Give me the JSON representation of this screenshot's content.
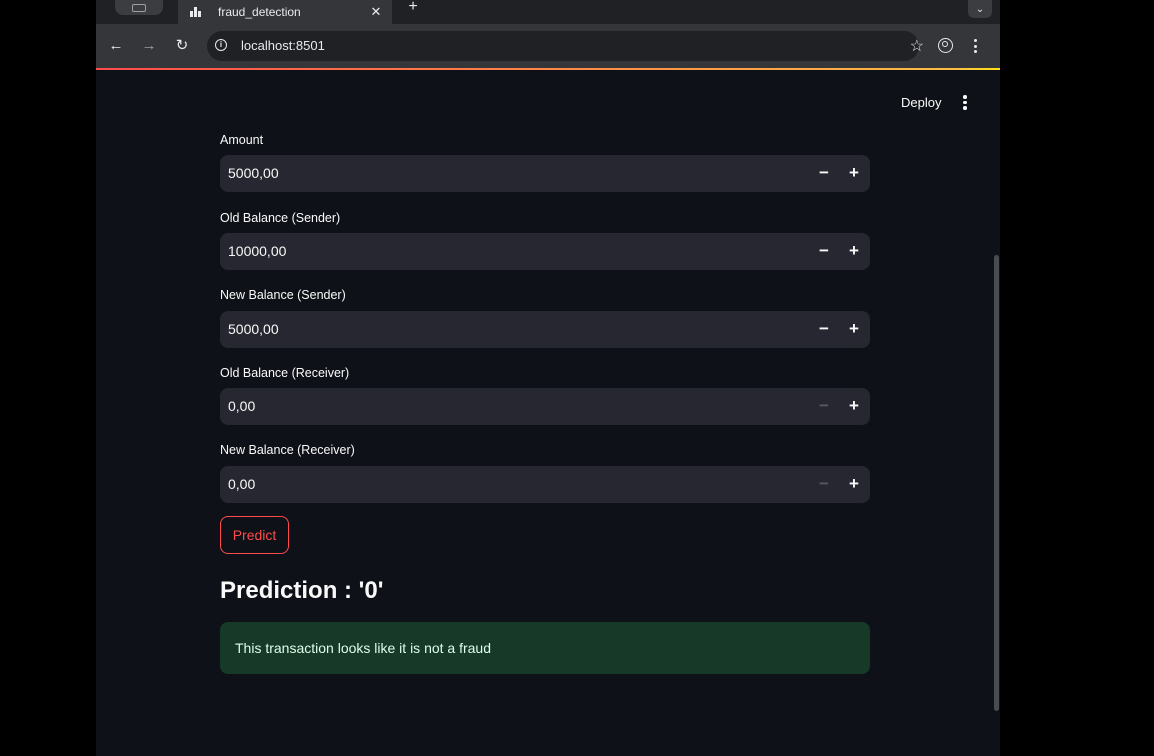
{
  "browser": {
    "tab": {
      "title": "fraud_detection",
      "close_glyph": "✕"
    },
    "new_tab_glyph": "+",
    "tab_search_glyph": "⌄",
    "back_glyph": "←",
    "forward_glyph": "→",
    "reload_glyph": "↻",
    "url": "localhost:8501",
    "info_glyph": "i",
    "star_glyph": "☆"
  },
  "app": {
    "deploy_label": "Deploy",
    "fields": [
      {
        "label": "Amount",
        "value": "5000,00",
        "minus_enabled": true
      },
      {
        "label": "Old Balance (Sender)",
        "value": "10000,00",
        "minus_enabled": true
      },
      {
        "label": "New Balance (Sender)",
        "value": "5000,00",
        "minus_enabled": true
      },
      {
        "label": "Old Balance (Receiver)",
        "value": "0,00",
        "minus_enabled": false
      },
      {
        "label": "New Balance (Receiver)",
        "value": "0,00",
        "minus_enabled": false
      }
    ],
    "minus_glyph": "−",
    "plus_glyph": "+",
    "predict_label": "Predict",
    "prediction_title": "Prediction : '0'",
    "result_message": "This transaction looks like it is not a fraud"
  },
  "colors": {
    "primary": "#ff4b4b",
    "background": "#0e1117",
    "input_bg": "#262730",
    "success_bg": "#173928"
  }
}
